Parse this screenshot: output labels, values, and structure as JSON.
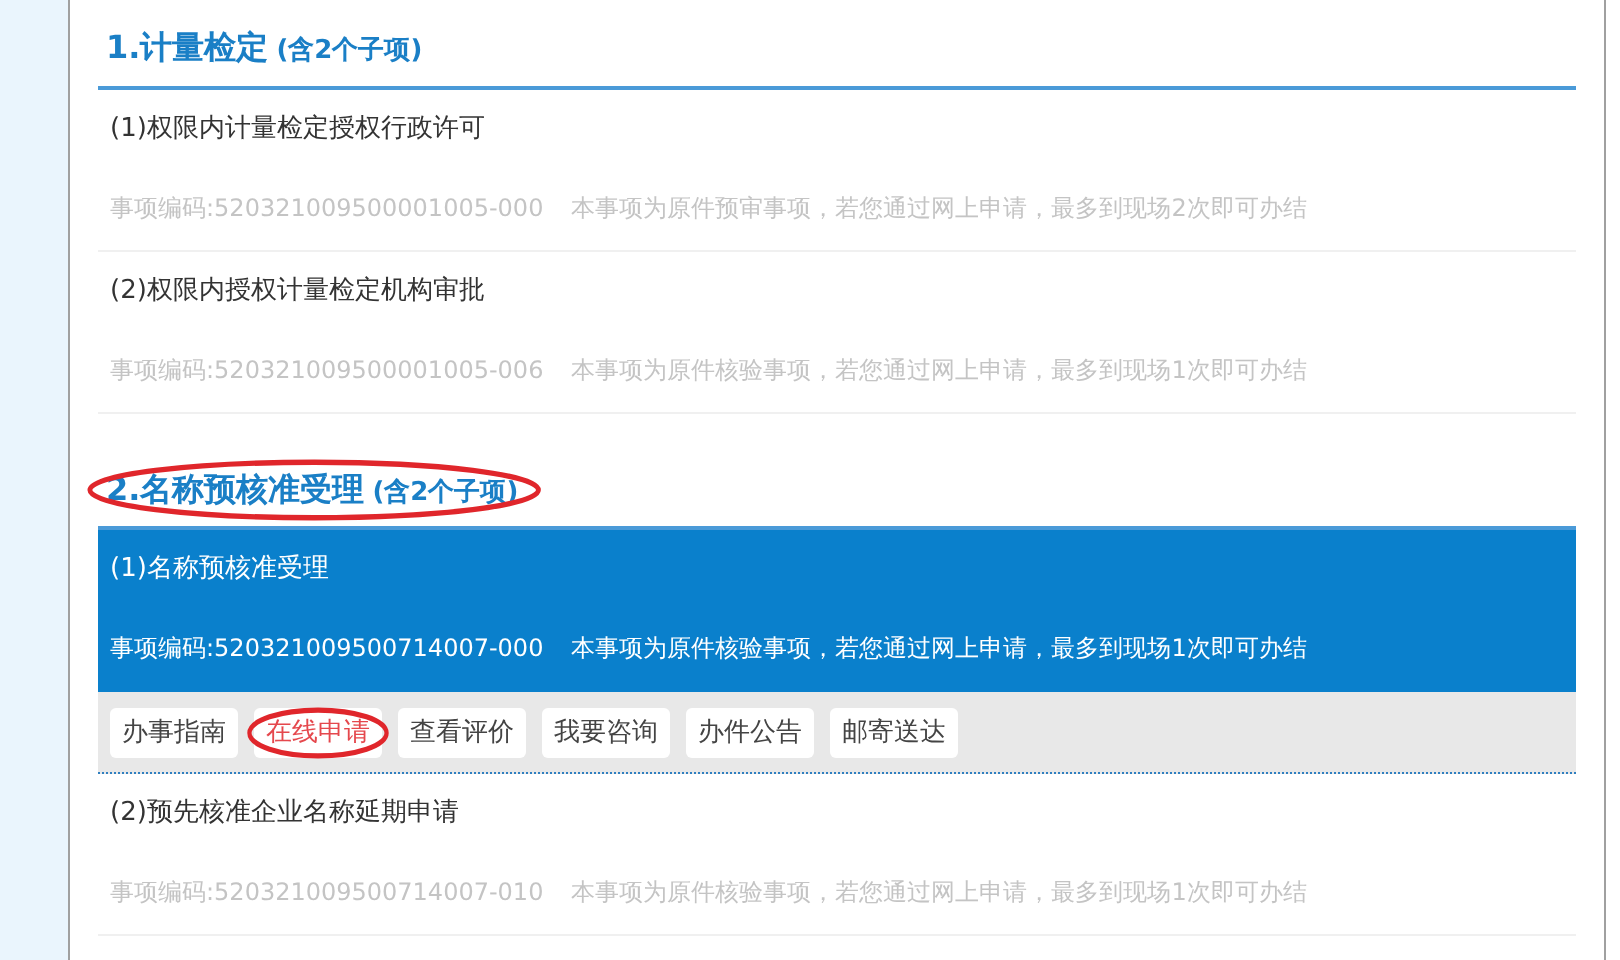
{
  "sections": [
    {
      "title": "1.计量检定",
      "count_note": "(含2个子项)",
      "circled": false,
      "items": [
        {
          "title": "(1)权限内计量检定授权行政许可",
          "code": "事项编码:520321009500001005-000",
          "note": "本事项为原件预审事项，若您通过网上申请，最多到现场2次即可办结",
          "selected": false
        },
        {
          "title": "(2)权限内授权计量检定机构审批",
          "code": "事项编码:520321009500001005-006",
          "note": "本事项为原件核验事项，若您通过网上申请，最多到现场1次即可办结",
          "selected": false
        }
      ]
    },
    {
      "title": "2.名称预核准受理",
      "count_note": "(含2个子项)",
      "circled": true,
      "items": [
        {
          "title": "(1)名称预核准受理",
          "code": "事项编码:520321009500714007-000",
          "note": "本事项为原件核验事项，若您通过网上申请，最多到现场1次即可办结",
          "selected": true,
          "actions": [
            {
              "label": "办事指南",
              "highlighted": false,
              "circled": false
            },
            {
              "label": "在线申请",
              "highlighted": true,
              "circled": true
            },
            {
              "label": "查看评价",
              "highlighted": false,
              "circled": false
            },
            {
              "label": "我要咨询",
              "highlighted": false,
              "circled": false
            },
            {
              "label": "办件公告",
              "highlighted": false,
              "circled": false
            },
            {
              "label": "邮寄送达",
              "highlighted": false,
              "circled": false
            }
          ]
        },
        {
          "title": "(2)预先核准企业名称延期申请",
          "code": "事项编码:520321009500714007-010",
          "note": "本事项为原件核验事项，若您通过网上申请，最多到现场1次即可办结",
          "selected": false
        }
      ]
    }
  ]
}
